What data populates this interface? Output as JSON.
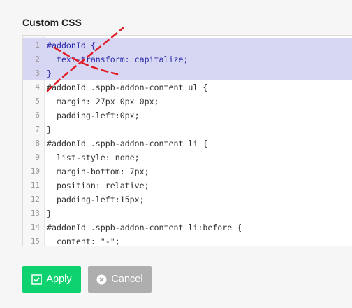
{
  "section_title": "Custom CSS",
  "editor": {
    "selected_text_color": "#2a2aa8",
    "lines": [
      {
        "num": "1",
        "code": "#addonId {",
        "selected": true
      },
      {
        "num": "2",
        "code": "  text-transform: capitalize;",
        "selected": true
      },
      {
        "num": "3",
        "code": "}",
        "selected": true
      },
      {
        "num": "4",
        "code": "#addonId .sppb-addon-content ul {",
        "selected": false
      },
      {
        "num": "5",
        "code": "  margin: 27px 0px 0px;",
        "selected": false
      },
      {
        "num": "6",
        "code": "  padding-left:0px;",
        "selected": false
      },
      {
        "num": "7",
        "code": "}",
        "selected": false
      },
      {
        "num": "8",
        "code": "#addonId .sppb-addon-content li {",
        "selected": false
      },
      {
        "num": "9",
        "code": "  list-style: none;",
        "selected": false
      },
      {
        "num": "10",
        "code": "  margin-bottom: 7px;",
        "selected": false
      },
      {
        "num": "11",
        "code": "  position: relative;",
        "selected": false
      },
      {
        "num": "12",
        "code": "  padding-left:15px;",
        "selected": false
      },
      {
        "num": "13",
        "code": "}",
        "selected": false
      },
      {
        "num": "14",
        "code": "#addonId .sppb-addon-content li:before {",
        "selected": false
      },
      {
        "num": "15",
        "code": "  content: \"-\";",
        "selected": false
      }
    ]
  },
  "buttons": {
    "apply": {
      "label": "Apply",
      "icon": "checkbox-check-icon",
      "color": "#0ed26f"
    },
    "cancel": {
      "label": "Cancel",
      "icon": "close-circle-icon",
      "color": "#aeaeae"
    }
  },
  "annotation": {
    "icon": "red-dashed-cross-mark-icon",
    "color": "#e01b24"
  }
}
